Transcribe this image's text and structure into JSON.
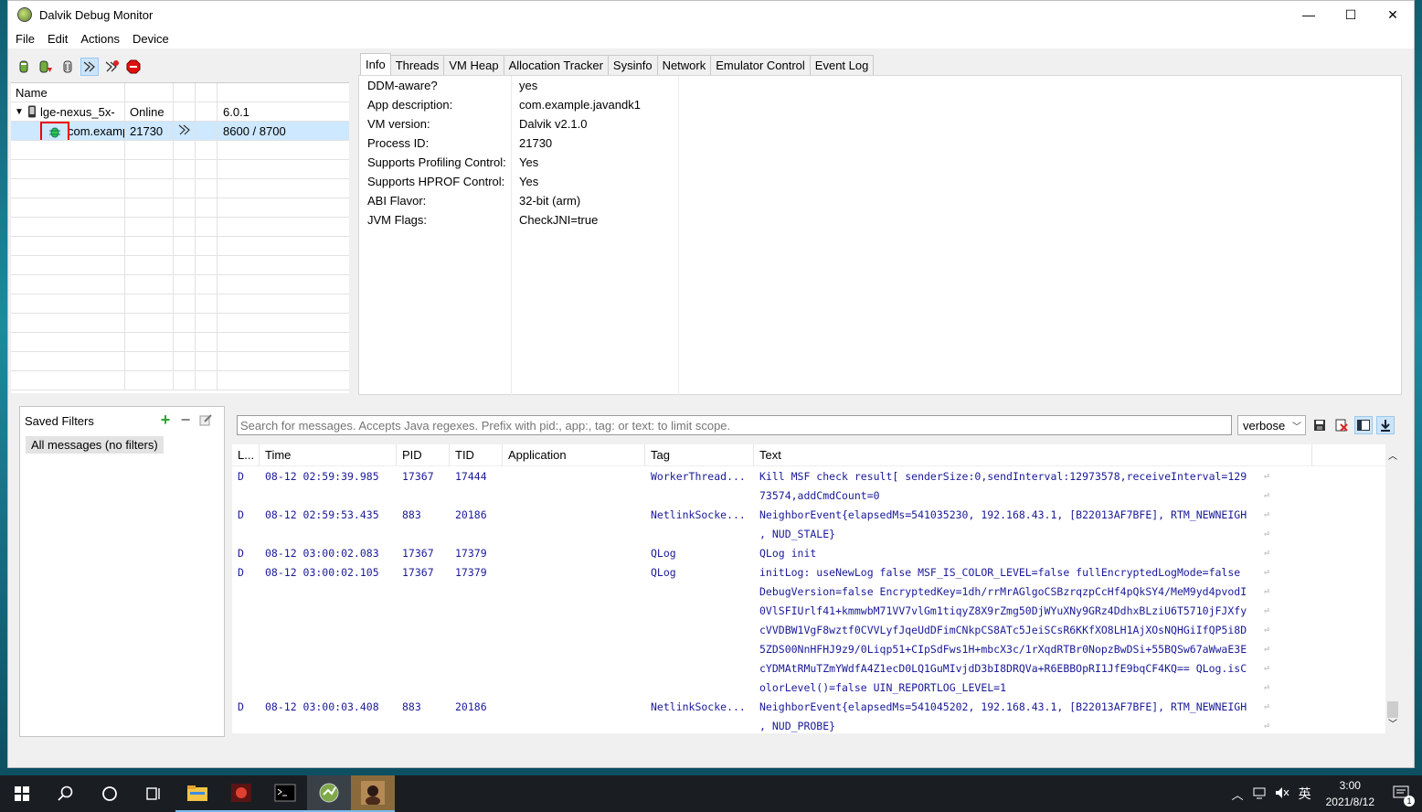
{
  "window": {
    "title": "Dalvik Debug Monitor",
    "minimize": "—",
    "maximize": "☐",
    "close": "✕"
  },
  "menu": [
    "File",
    "Edit",
    "Actions",
    "Device"
  ],
  "devices": {
    "header": "Name",
    "device": {
      "name": "lge-nexus_5x-",
      "status": "Online",
      "version": "6.0.1"
    },
    "process": {
      "name": "com.examp",
      "pid": "21730",
      "ports": "8600 / 8700"
    }
  },
  "tabs": [
    "Info",
    "Threads",
    "VM Heap",
    "Allocation Tracker",
    "Sysinfo",
    "Network",
    "Emulator Control",
    "Event Log"
  ],
  "info": [
    {
      "k": "DDM-aware?",
      "v": "yes"
    },
    {
      "k": "App description:",
      "v": "com.example.javandk1"
    },
    {
      "k": "VM version:",
      "v": "Dalvik v2.1.0"
    },
    {
      "k": "Process ID:",
      "v": "21730"
    },
    {
      "k": "Supports Profiling Control:",
      "v": "Yes"
    },
    {
      "k": "Supports HPROF Control:",
      "v": "Yes"
    },
    {
      "k": "ABI Flavor:",
      "v": "32-bit (arm)"
    },
    {
      "k": "JVM Flags:",
      "v": "CheckJNI=true"
    }
  ],
  "filters": {
    "title": "Saved Filters",
    "all": "All messages (no filters)"
  },
  "logcat": {
    "search_placeholder": "Search for messages. Accepts Java regexes. Prefix with pid:, app:, tag: or text: to limit scope.",
    "level": "verbose",
    "columns": [
      "L...",
      "Time",
      "PID",
      "TID",
      "Application",
      "Tag",
      "Text"
    ],
    "rows": [
      {
        "l": "D",
        "time": "08-12 02:59:39.985",
        "pid": "17367",
        "tid": "17444",
        "app": "",
        "tag": "WorkerThread...",
        "text": "Kill MSF check result[ senderSize:0,sendInterval:12973578,receiveInterval=129"
      },
      {
        "l": "",
        "time": "",
        "pid": "",
        "tid": "",
        "app": "",
        "tag": "",
        "text": "73574,addCmdCount=0"
      },
      {
        "l": "D",
        "time": "08-12 02:59:53.435",
        "pid": "883",
        "tid": "20186",
        "app": "",
        "tag": "NetlinkSocke...",
        "text": "NeighborEvent{elapsedMs=541035230, 192.168.43.1, [B22013AF7BFE], RTM_NEWNEIGH"
      },
      {
        "l": "",
        "time": "",
        "pid": "",
        "tid": "",
        "app": "",
        "tag": "",
        "text": ", NUD_STALE}"
      },
      {
        "l": "D",
        "time": "08-12 03:00:02.083",
        "pid": "17367",
        "tid": "17379",
        "app": "",
        "tag": "QLog",
        "text": "QLog init"
      },
      {
        "l": "D",
        "time": "08-12 03:00:02.105",
        "pid": "17367",
        "tid": "17379",
        "app": "",
        "tag": "QLog",
        "text": "initLog: useNewLog false MSF_IS_COLOR_LEVEL=false fullEncryptedLogMode=false"
      },
      {
        "l": "",
        "time": "",
        "pid": "",
        "tid": "",
        "app": "",
        "tag": "",
        "text": "DebugVersion=false EncryptedKey=1dh/rrMrAGlgoCSBzrqzpCcHf4pQkSY4/MeM9yd4pvodI"
      },
      {
        "l": "",
        "time": "",
        "pid": "",
        "tid": "",
        "app": "",
        "tag": "",
        "text": "0VlSFIUrlf41+kmmwbM71VV7vlGm1tiqyZ8X9rZmg50DjWYuXNy9GRz4DdhxBLziU6T5710jFJXfy"
      },
      {
        "l": "",
        "time": "",
        "pid": "",
        "tid": "",
        "app": "",
        "tag": "",
        "text": "cVVDBW1VgF8wztf0CVVLyfJqeUdDFimCNkpCS8ATc5JeiSCsR6KKfXO8LH1AjXOsNQHGiIfQP5i8D"
      },
      {
        "l": "",
        "time": "",
        "pid": "",
        "tid": "",
        "app": "",
        "tag": "",
        "text": "5ZDS00NnHFHJ9z9/0Liqp51+CIpSdFws1H+mbcX3c/1rXqdRTBr0NopzBwDSi+55BQSw67aWwaE3E"
      },
      {
        "l": "",
        "time": "",
        "pid": "",
        "tid": "",
        "app": "",
        "tag": "",
        "text": "cYDMAtRMuTZmYWdfA4Z1ecD0LQ1GuMIvjdD3bI8DRQVa+R6EBBOpRI1JfE9bqCF4KQ== QLog.isC"
      },
      {
        "l": "",
        "time": "",
        "pid": "",
        "tid": "",
        "app": "",
        "tag": "",
        "text": "olorLevel()=false UIN_REPORTLOG_LEVEL=1"
      },
      {
        "l": "D",
        "time": "08-12 03:00:03.408",
        "pid": "883",
        "tid": "20186",
        "app": "",
        "tag": "NetlinkSocke...",
        "text": "NeighborEvent{elapsedMs=541045202, 192.168.43.1, [B22013AF7BFE], RTM_NEWNEIGH"
      },
      {
        "l": "",
        "time": "",
        "pid": "",
        "tid": "",
        "app": "",
        "tag": "",
        "text": ", NUD_PROBE}"
      }
    ]
  },
  "taskbar": {
    "time": "3:00",
    "date": "2021/8/12",
    "ime": "英",
    "notif_count": "1"
  }
}
